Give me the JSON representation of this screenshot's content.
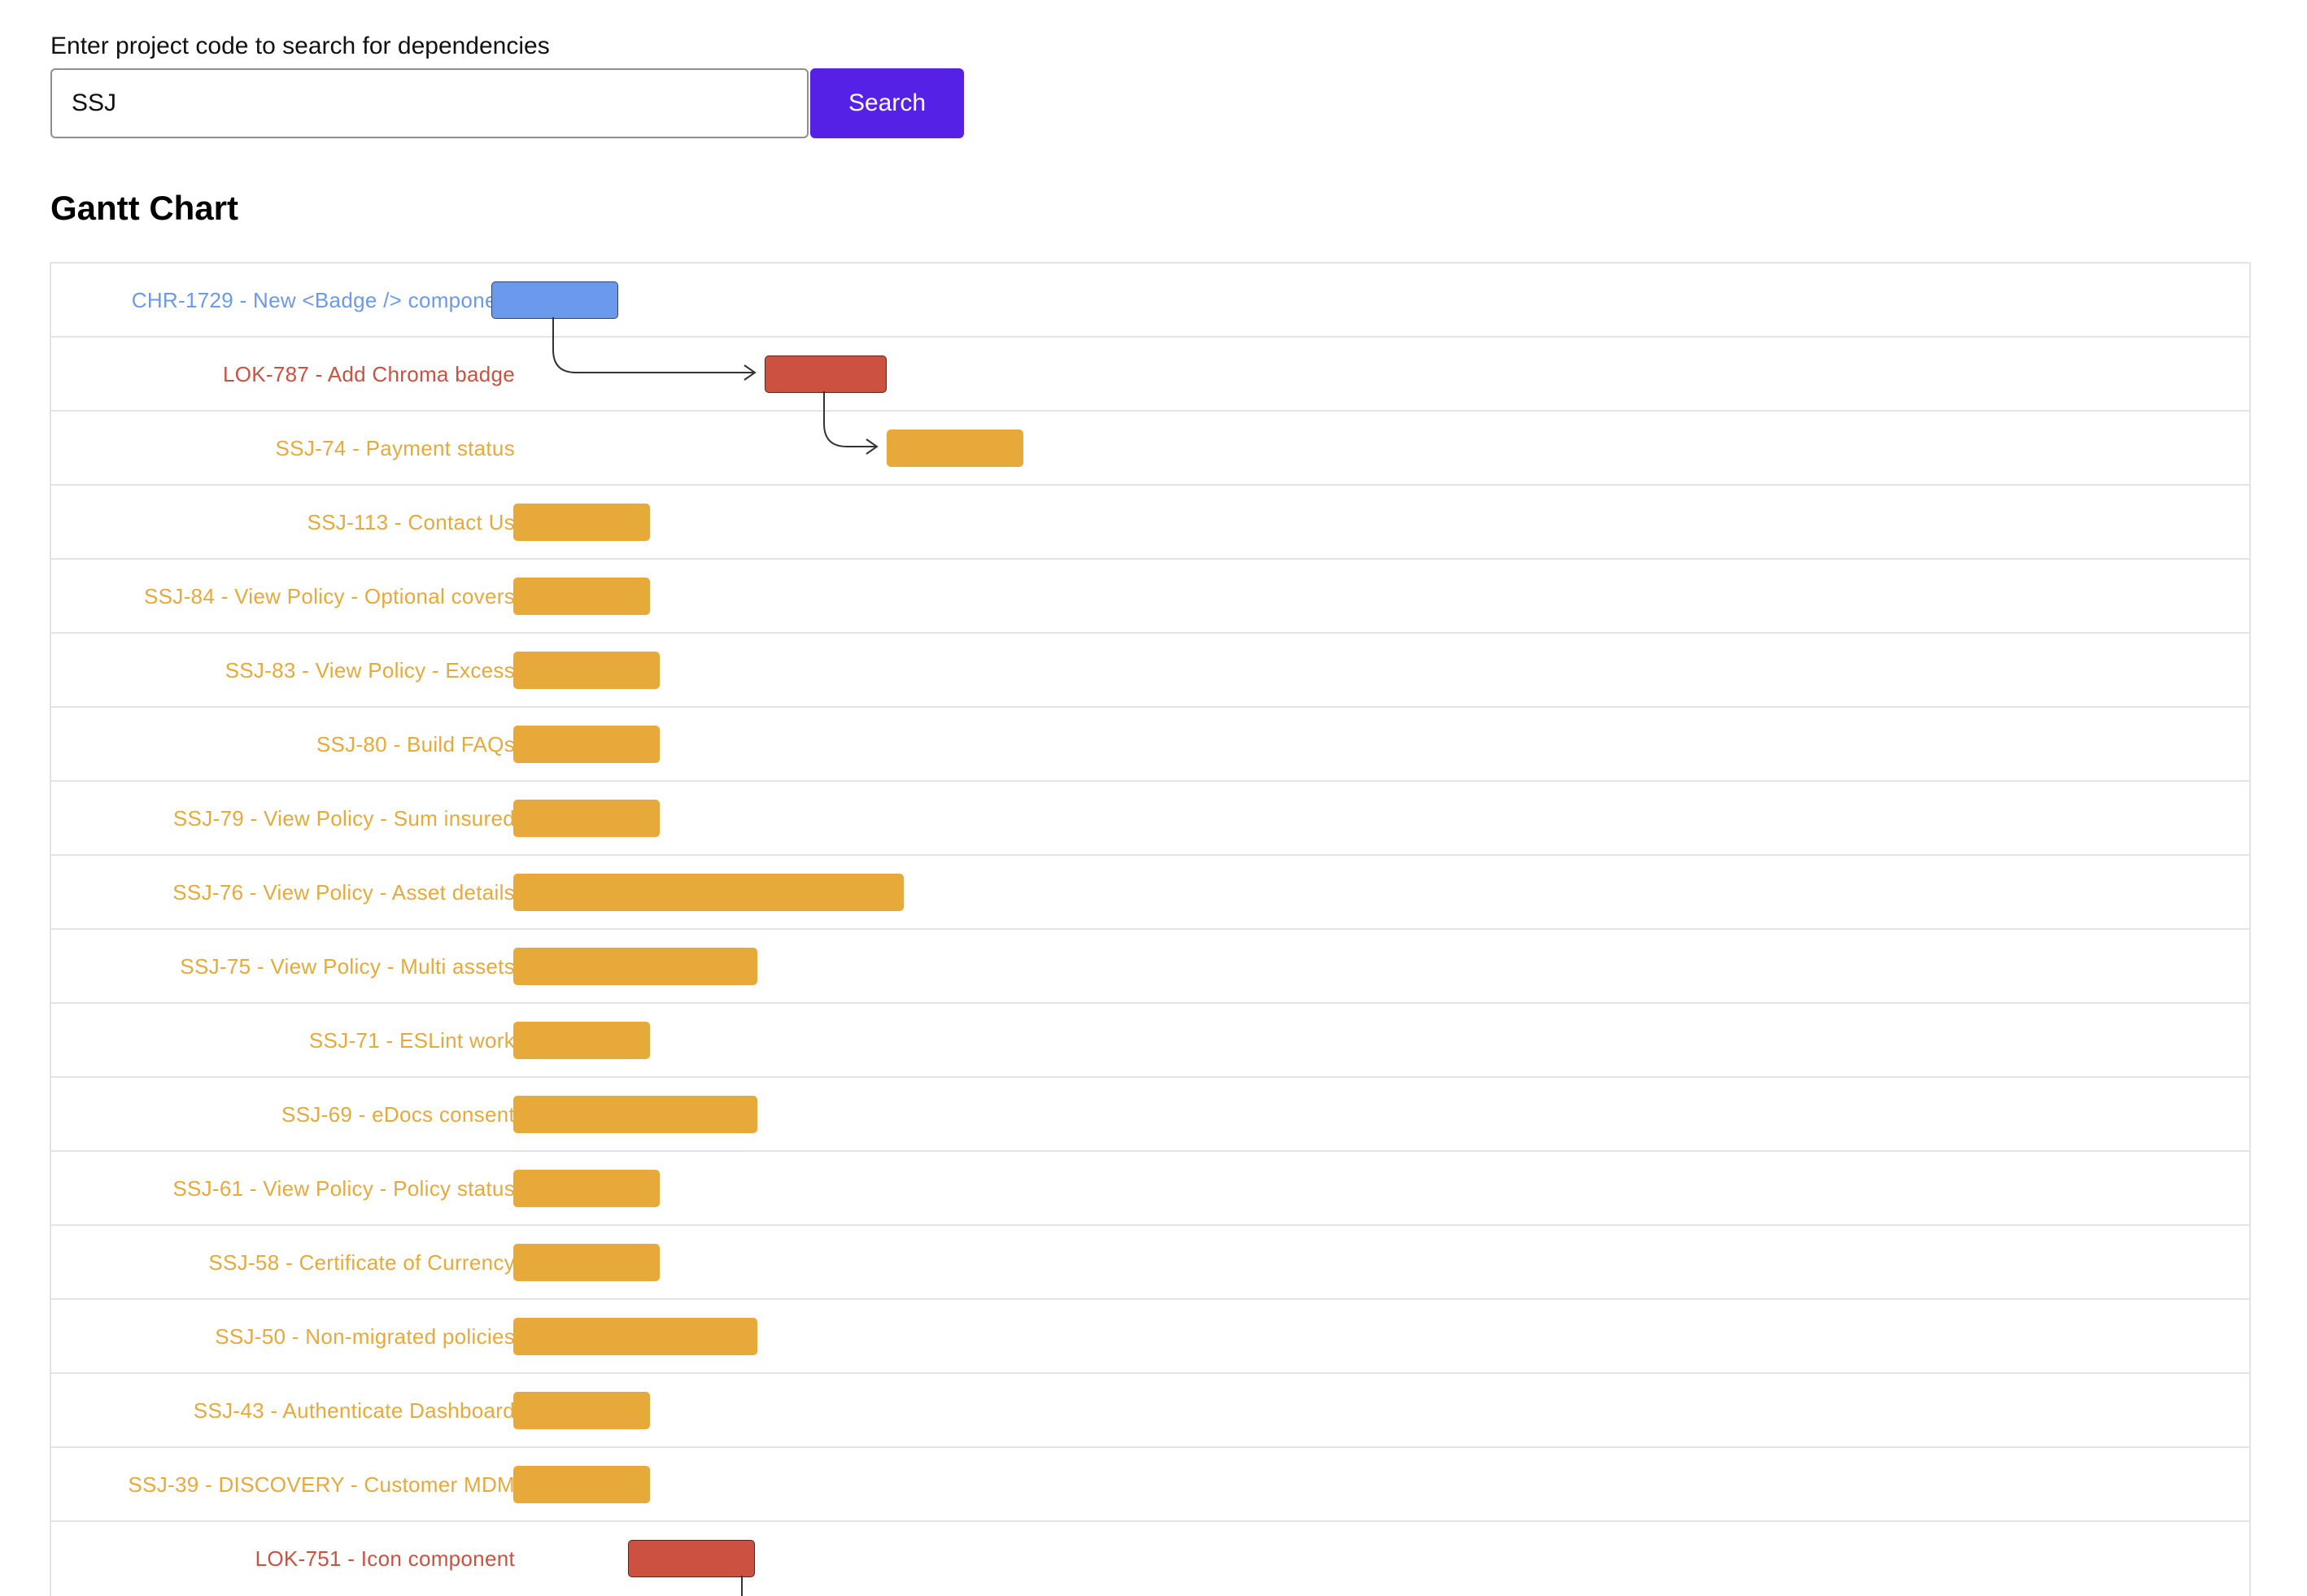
{
  "search": {
    "label": "Enter project code to search for dependencies",
    "value": "SSJ",
    "button_label": "Search",
    "button_color": "#5521e6",
    "button_text_color": "#ffffff"
  },
  "section_title": "Gantt Chart",
  "colors": {
    "CHR": "#6b99eb",
    "LOK": "#cc5140",
    "SSJ": "#e8a93b"
  },
  "chart_data": {
    "type": "gantt",
    "title": "Gantt Chart",
    "tasks": [
      {
        "label": "CHR-1729 - New <Badge /> component",
        "project": "CHR",
        "start": 0,
        "end": 13
      },
      {
        "label": "LOK-787 - Add Chroma badge",
        "project": "LOK",
        "start": 28,
        "end": 40.5
      },
      {
        "label": "SSJ-74 - Payment status",
        "project": "SSJ",
        "start": 40.5,
        "end": 54.5
      },
      {
        "label": "SSJ-113 - Contact Us",
        "project": "SSJ",
        "start": 2.25,
        "end": 16.25
      },
      {
        "label": "SSJ-84 - View Policy - Optional covers",
        "project": "SSJ",
        "start": 2.25,
        "end": 16.25
      },
      {
        "label": "SSJ-83 - View Policy - Excess",
        "project": "SSJ",
        "start": 2.25,
        "end": 17.25
      },
      {
        "label": "SSJ-80 - Build FAQs",
        "project": "SSJ",
        "start": 2.25,
        "end": 17.25
      },
      {
        "label": "SSJ-79 - View Policy - Sum insured",
        "project": "SSJ",
        "start": 2.25,
        "end": 17.25
      },
      {
        "label": "SSJ-76 - View Policy - Asset details",
        "project": "SSJ",
        "start": 2.25,
        "end": 42.25
      },
      {
        "label": "SSJ-75 - View Policy - Multi assets",
        "project": "SSJ",
        "start": 2.25,
        "end": 27.25
      },
      {
        "label": "SSJ-71 - ESLint work",
        "project": "SSJ",
        "start": 2.25,
        "end": 16.25
      },
      {
        "label": "SSJ-69 - eDocs consent",
        "project": "SSJ",
        "start": 2.25,
        "end": 27.25
      },
      {
        "label": "SSJ-61 - View Policy - Policy status",
        "project": "SSJ",
        "start": 2.25,
        "end": 17.25
      },
      {
        "label": "SSJ-58 - Certificate of Currency",
        "project": "SSJ",
        "start": 2.25,
        "end": 17.25
      },
      {
        "label": "SSJ-50 - Non-migrated policies",
        "project": "SSJ",
        "start": 2.25,
        "end": 27.25
      },
      {
        "label": "SSJ-43 - Authenticate Dashboard",
        "project": "SSJ",
        "start": 2.25,
        "end": 16.25
      },
      {
        "label": "SSJ-39 - DISCOVERY - Customer MDM",
        "project": "SSJ",
        "start": 2.25,
        "end": 16.25
      },
      {
        "label": "LOK-751 - Icon component",
        "project": "LOK",
        "start": 14,
        "end": 27
      }
    ],
    "dependencies": [
      {
        "from": 0,
        "to": 1
      },
      {
        "from": 1,
        "to": 2
      }
    ]
  }
}
